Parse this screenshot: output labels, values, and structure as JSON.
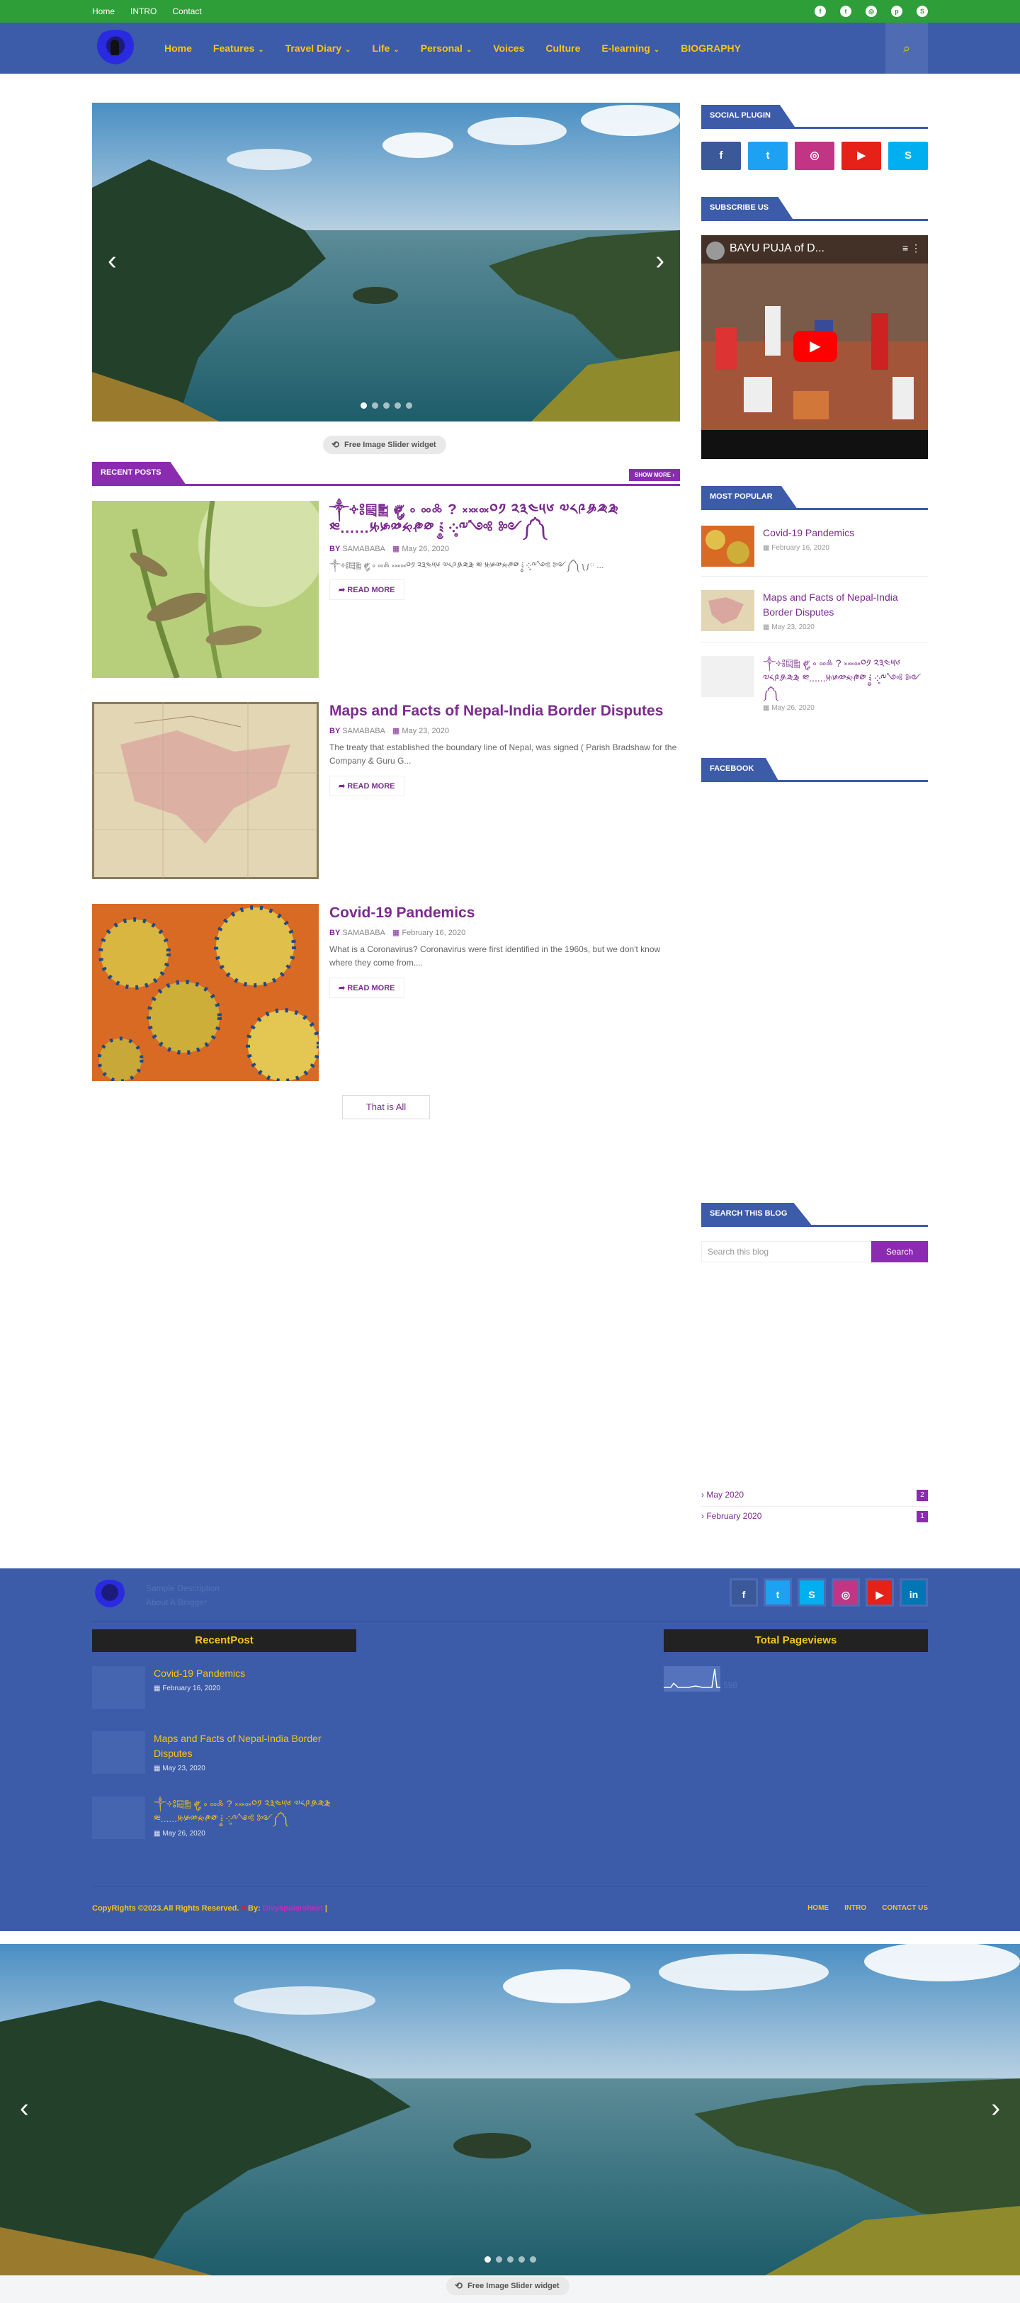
{
  "topbar": {
    "links": [
      "Home",
      "INTRO",
      "Contact"
    ],
    "social_icons": [
      "facebook-icon",
      "twitter-icon",
      "instagram-icon",
      "pinterest-icon",
      "skype-icon"
    ],
    "bg_color": "#2e9e39"
  },
  "nav": {
    "items": [
      {
        "label": "Home",
        "dropdown": false
      },
      {
        "label": "Features",
        "dropdown": true
      },
      {
        "label": "Travel Diary",
        "dropdown": true
      },
      {
        "label": "Life",
        "dropdown": true
      },
      {
        "label": "Personal",
        "dropdown": true
      },
      {
        "label": "Voices",
        "dropdown": false
      },
      {
        "label": "Culture",
        "dropdown": false
      },
      {
        "label": "E-learning",
        "dropdown": true
      },
      {
        "label": "BIOGRAPHY",
        "dropdown": false
      }
    ],
    "bg_color": "#3c5ba8",
    "link_color": "#f5c518"
  },
  "slider": {
    "dot_count": 5,
    "active_dot": 0,
    "credit": "Free Image Slider widget"
  },
  "recent_posts": {
    "heading": "RECENT POSTS",
    "show_more": "SHOW MORE",
    "posts": [
      {
        "title": "༒༓༔༕༖ ༗༘༙ ༚ ༛༜ ? ༝༞༟༠༡ ༢༣༤༥༦ ༧༨༩༪༫༬ ༭......༮༯༰༱༲༳ ༴༵ ༶༷༸༹༺ ༻༼༽ ",
        "by": "BY",
        "author": "SAMABABA",
        "date": "May 26, 2020",
        "excerpt": "༒༓༔༕༖ ༗༘༙ ༚ ༛༜ ༝༞༟༠༡ ༢༣༤༥༦ ༧༨༩༪༫༬ ༭ ༮༯༰༱༲༳ ༴༵ ༶༷༸༹༺ ༻༼༽ ༾༿ ...",
        "read_more": "READ MORE"
      },
      {
        "title": "Maps and Facts of Nepal-India Border Disputes",
        "by": "BY",
        "author": "SAMABABA",
        "date": "May 23, 2020",
        "excerpt": "The treaty that established the boundary line of Nepal, was signed ( Parish Bradshaw for the Company & Guru G...",
        "read_more": "READ MORE"
      },
      {
        "title": "Covid-19 Pandemics",
        "by": "BY",
        "author": "SAMABABA",
        "date": "February 16, 2020",
        "excerpt": "What is a Coronavirus? Coronavirus were first identified in the 1960s, but we don't know where they come from....",
        "read_more": "READ MORE"
      }
    ],
    "end_label": "That is All"
  },
  "sidebar": {
    "social_heading": "SOCIAL PLUGIN",
    "social_buttons": [
      {
        "icon": "facebook-icon",
        "glyph": "f",
        "color": "#3b5998"
      },
      {
        "icon": "twitter-icon",
        "glyph": "t",
        "color": "#1da1f2"
      },
      {
        "icon": "instagram-icon",
        "glyph": "◎",
        "color": "#c13584"
      },
      {
        "icon": "youtube-icon",
        "glyph": "▶",
        "color": "#e62117"
      },
      {
        "icon": "skype-icon",
        "glyph": "S",
        "color": "#00aff0"
      }
    ],
    "subscribe_heading": "SUBSCRIBE US",
    "video_title": "BAYU PUJA of D...",
    "popular_heading": "MOST POPULAR",
    "popular": [
      {
        "title": "Covid-19 Pandemics",
        "date": "February 16, 2020"
      },
      {
        "title": "Maps and Facts of Nepal-India Border Disputes",
        "date": "May 23, 2020"
      },
      {
        "title": "༒༓༔༕༖ ༗༘༙ ༚ ༛༜ ? ༝༞༟༠༡ ༢༣༤༥༦ ༧༨༩༪༫༬ ༭......༮༯༰༱༲༳ ༴༵ ༶༷༸༹༺ ༻༼༽ ",
        "date": "May 26, 2020"
      }
    ],
    "facebook_heading": "FACEBOOK",
    "search_heading": "SEARCH THIS BLOG",
    "search_placeholder": "Search this blog",
    "search_button": "Search",
    "archive": [
      {
        "label": "› May 2020",
        "count": "2"
      },
      {
        "label": "› February 2020",
        "count": "1"
      }
    ]
  },
  "footer": {
    "description_line1": "Sample Description",
    "description_line2": "About A Blogger",
    "social": [
      {
        "icon": "facebook-icon",
        "glyph": "f",
        "color": "#3b5998"
      },
      {
        "icon": "twitter-icon",
        "glyph": "t",
        "color": "#1da1f2"
      },
      {
        "icon": "skype-icon",
        "glyph": "S",
        "color": "#00aff0"
      },
      {
        "icon": "instagram-icon",
        "glyph": "◎",
        "color": "#c13584"
      },
      {
        "icon": "youtube-icon",
        "glyph": "▶",
        "color": "#e62117"
      },
      {
        "icon": "linkedin-icon",
        "glyph": "in",
        "color": "#0077b5"
      }
    ],
    "recent_heading": "RecentPost",
    "pageviews_heading": "Total Pageviews",
    "pageviews_count": "598",
    "recent": [
      {
        "title": "Covid-19 Pandemics",
        "date": "February 16, 2020"
      },
      {
        "title": "Maps and Facts of Nepal-India Border Disputes",
        "date": "May 23, 2020"
      },
      {
        "title": "༒༓༔༕༖ ༗༘༙ ༚ ༛༜ ? ༝༞༟༠༡ ༢༣༤༥༦ ༧༨༩༪༫༬ ༭......༮༯༰༱༲༳ ༴༵ ༶༷༸༹༺ ༻༼༽ ",
        "date": "May 26, 2020"
      }
    ],
    "copyright": "CopyRights ©2023.All Rights Reserved.",
    "by": "By:",
    "author_link": "Divyapolarsheet",
    "suffix": "|",
    "links": [
      "HOME",
      "INTRO",
      "CONTACT US"
    ]
  },
  "bottom_slider": {
    "dot_count": 5,
    "active_dot": 0,
    "credit": "Free Image Slider widget"
  }
}
